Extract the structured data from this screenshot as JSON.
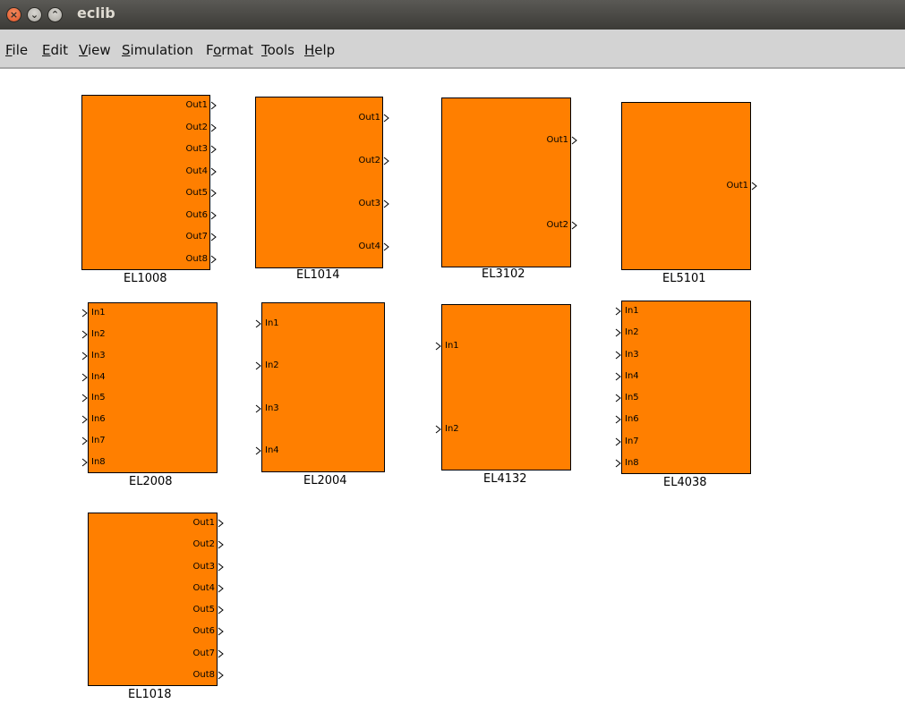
{
  "window": {
    "title": "eclib"
  },
  "menu": [
    {
      "pre": "",
      "u": "F",
      "post": "ile"
    },
    {
      "pre": "",
      "u": "E",
      "post": "dit"
    },
    {
      "pre": "",
      "u": "V",
      "post": "iew"
    },
    {
      "pre": "",
      "u": "S",
      "post": "imulation"
    },
    {
      "pre": "F",
      "u": "o",
      "post": "rmat"
    },
    {
      "pre": "",
      "u": "T",
      "post": "ools"
    },
    {
      "pre": "",
      "u": "H",
      "post": "elp"
    }
  ],
  "blocks": [
    {
      "label": "EL1008",
      "ports": [
        "Out1",
        "Out2",
        "Out3",
        "Out4",
        "Out5",
        "Out6",
        "Out7",
        "Out8"
      ],
      "kind": "out"
    },
    {
      "label": "EL1014",
      "ports": [
        "Out1",
        "Out2",
        "Out3",
        "Out4"
      ],
      "kind": "out"
    },
    {
      "label": "EL3102",
      "ports": [
        "Out1",
        "Out2"
      ],
      "kind": "out"
    },
    {
      "label": "EL5101",
      "ports": [
        "Out1"
      ],
      "kind": "out"
    },
    {
      "label": "EL2008",
      "ports": [
        "In1",
        "In2",
        "In3",
        "In4",
        "In5",
        "In6",
        "In7",
        "In8"
      ],
      "kind": "in"
    },
    {
      "label": "EL2004",
      "ports": [
        "In1",
        "In2",
        "In3",
        "In4"
      ],
      "kind": "in"
    },
    {
      "label": "EL4132",
      "ports": [
        "In1",
        "In2"
      ],
      "kind": "in"
    },
    {
      "label": "EL4038",
      "ports": [
        "In1",
        "In2",
        "In3",
        "In4",
        "In5",
        "In6",
        "In7",
        "In8"
      ],
      "kind": "in"
    },
    {
      "label": "EL1018",
      "ports": [
        "Out1",
        "Out2",
        "Out3",
        "Out4",
        "Out5",
        "Out6",
        "Out7",
        "Out8"
      ],
      "kind": "out"
    }
  ]
}
